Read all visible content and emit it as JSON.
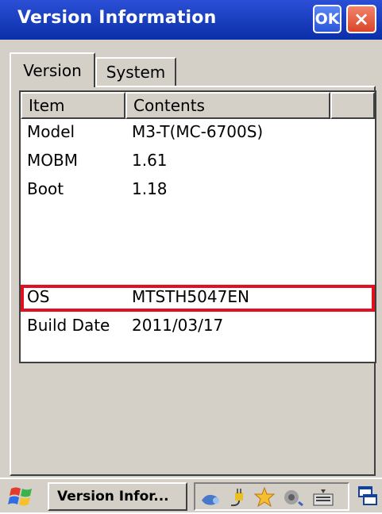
{
  "window": {
    "title": "Version Information",
    "ok_label": "OK",
    "close_label": "×"
  },
  "tabs": [
    {
      "label": "Version"
    },
    {
      "label": "System"
    }
  ],
  "list": {
    "columns": [
      {
        "label": "Item"
      },
      {
        "label": "Contents"
      }
    ],
    "rows": [
      {
        "item": "Model",
        "contents": "M3-T(MC-6700S)"
      },
      {
        "item": "MOBM",
        "contents": "1.61"
      },
      {
        "item": "Boot",
        "contents": "1.18"
      },
      {
        "item": "OS",
        "contents": "MTSTH5047EN"
      },
      {
        "item": "Build Date",
        "contents": "2011/03/17"
      }
    ],
    "highlight_color": "#e01020"
  },
  "taskbar": {
    "task_label": "Version Infor...",
    "icons": [
      "start-windows-icon",
      "network-icon",
      "power-plug-icon",
      "star-icon",
      "audio-icon",
      "keyboard-icon",
      "desktop-icon"
    ]
  },
  "colors": {
    "titlebar": "#0b2fa8",
    "face": "#d4d0c8"
  }
}
